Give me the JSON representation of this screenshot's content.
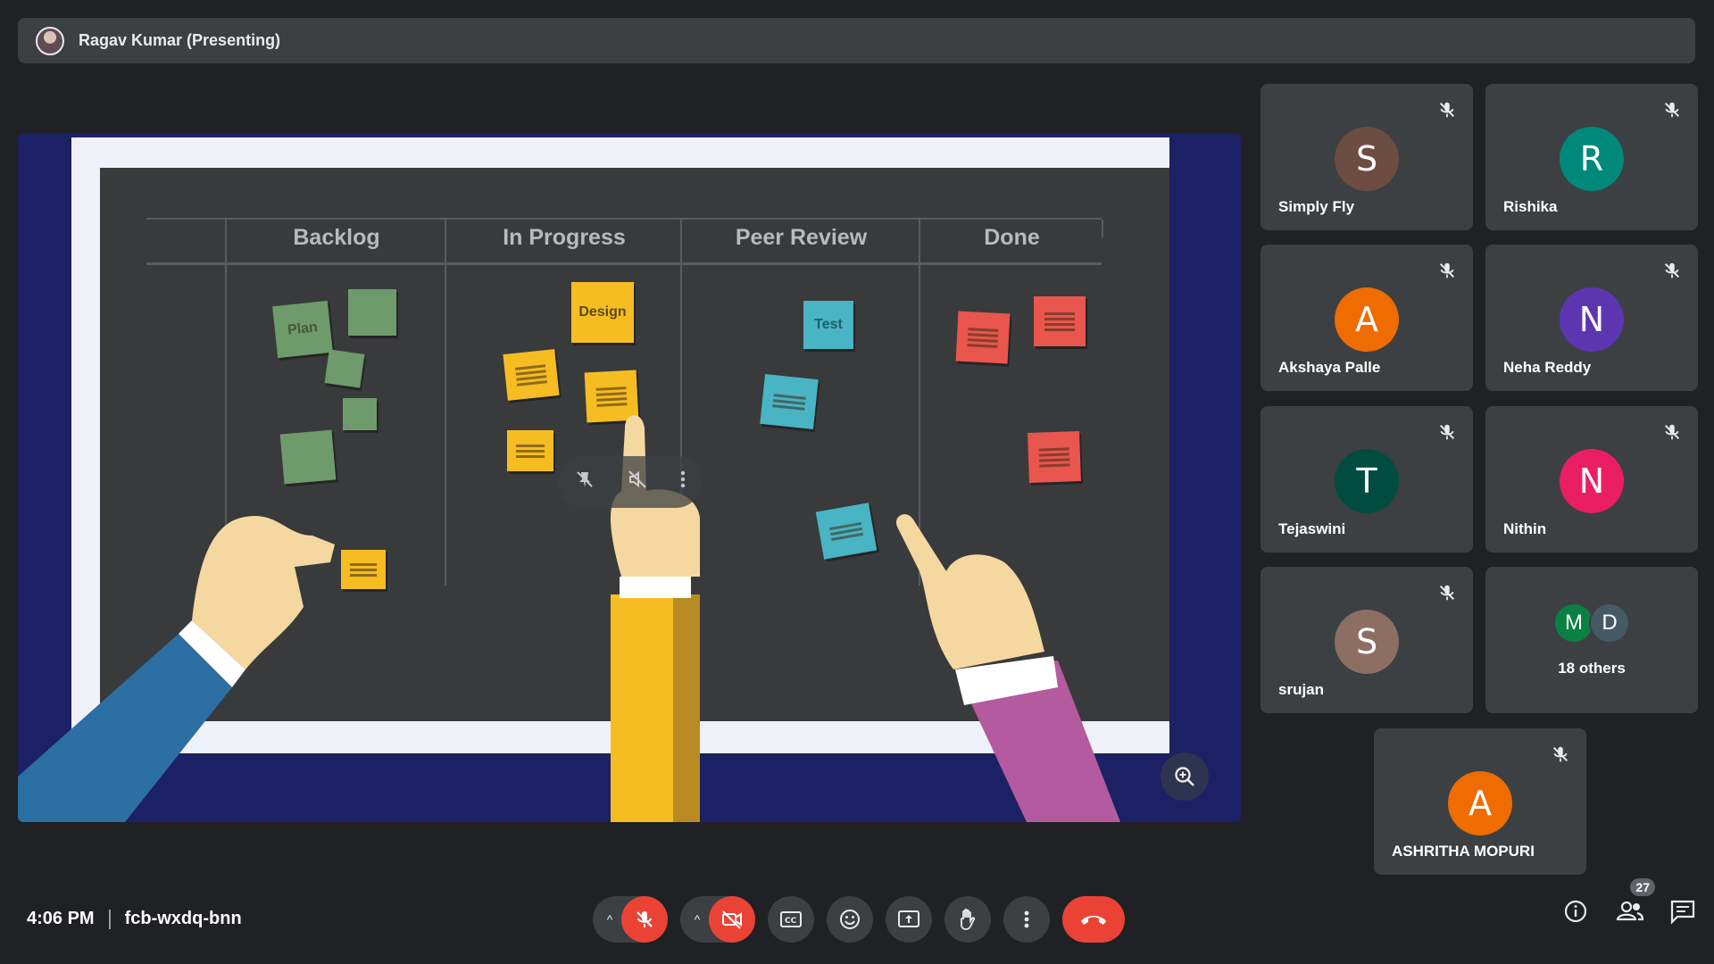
{
  "presenter": {
    "label": "Ragav Kumar (Presenting)"
  },
  "board": {
    "columns": [
      "Backlog",
      "In Progress",
      "Peer Review",
      "Done"
    ],
    "sticky_labels": {
      "plan": "Plan",
      "design": "Design",
      "test": "Test"
    }
  },
  "participants": [
    {
      "initial": "S",
      "name": "Simply Fly",
      "color": "#6d4c41"
    },
    {
      "initial": "R",
      "name": "Rishika",
      "color": "#00897b"
    },
    {
      "initial": "A",
      "name": "Akshaya Palle",
      "color": "#ef6c00"
    },
    {
      "initial": "N",
      "name": "Neha Reddy",
      "color": "#5e35b1"
    },
    {
      "initial": "T",
      "name": "Tejaswini",
      "color": "#004d40"
    },
    {
      "initial": "N",
      "name": "Nithin",
      "color": "#e91e63"
    },
    {
      "initial": "S",
      "name": "srujan",
      "color": "#8d6e63"
    },
    {
      "initial": "A",
      "name": "ASHRITHA MOPURI",
      "color": "#ef6c00"
    }
  ],
  "others": {
    "initials": [
      "M",
      "D"
    ],
    "colors": [
      "#0b8043",
      "#455a64"
    ],
    "label": "18 others"
  },
  "meeting": {
    "time": "4:06 PM",
    "code": "fcb-wxdq-bnn"
  },
  "people_count": "27"
}
